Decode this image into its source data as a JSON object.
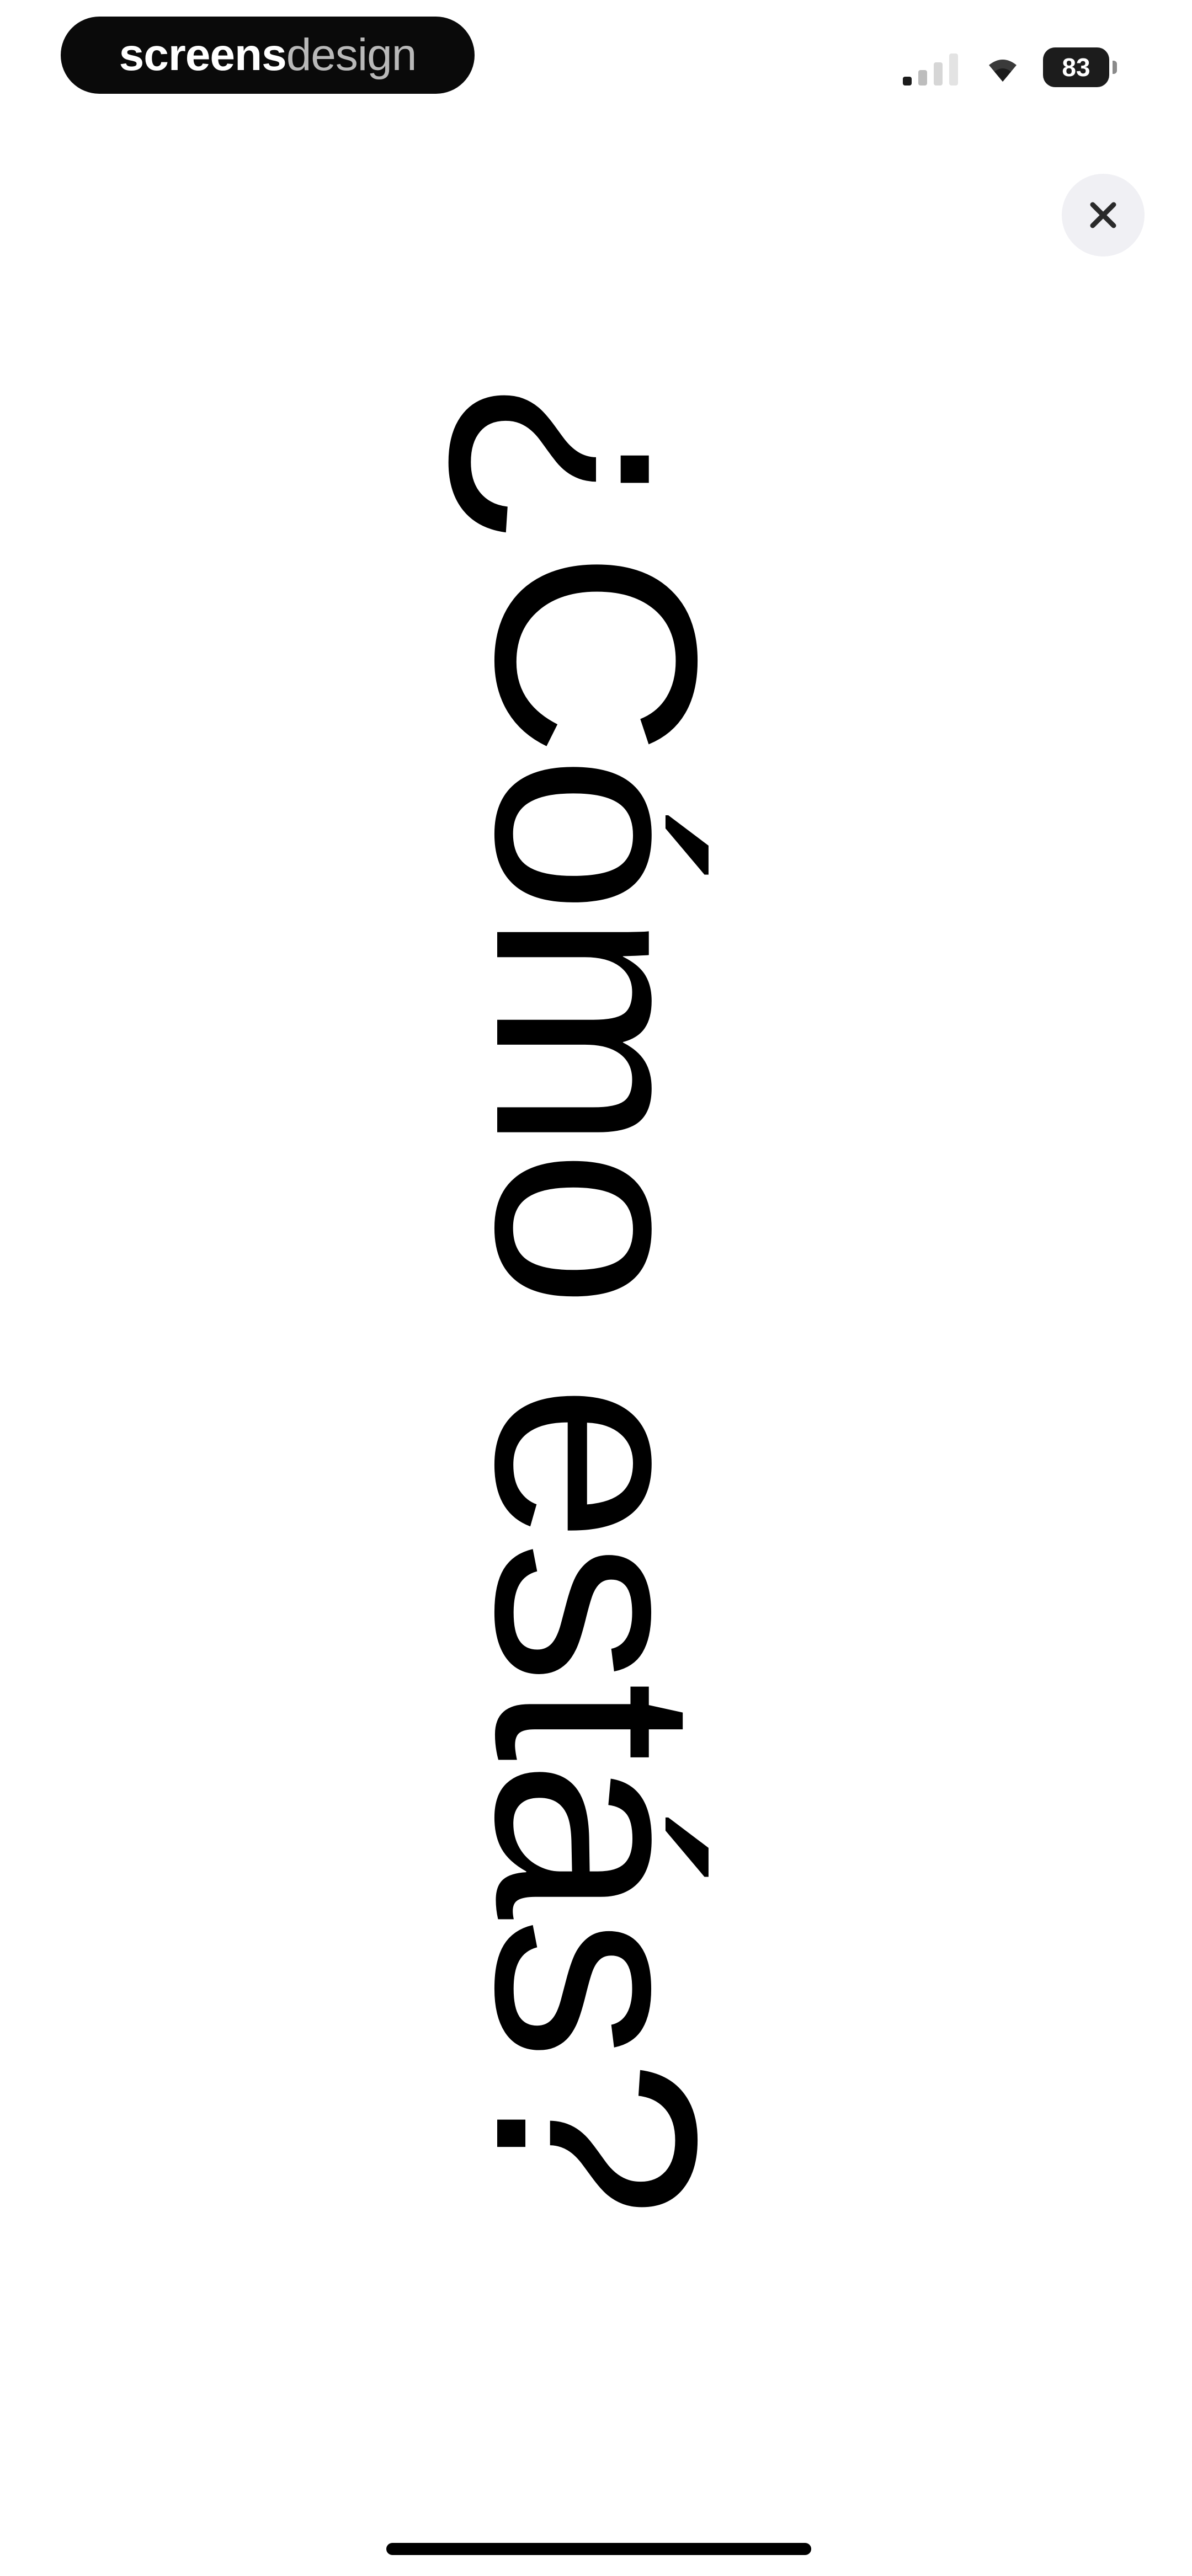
{
  "status_bar": {
    "brand_part1": "screens",
    "brand_part2": "design",
    "battery_level": "83",
    "signal_icon": "cellular-signal-icon",
    "wifi_icon": "wifi-icon",
    "battery_icon": "battery-icon"
  },
  "close_button": {
    "icon": "close-icon"
  },
  "main": {
    "heading": "¿Cómo estás?"
  },
  "colors": {
    "background": "#ffffff",
    "text": "#000000",
    "pill": "#0a0a0a",
    "close_bg": "#f0f0f4"
  }
}
